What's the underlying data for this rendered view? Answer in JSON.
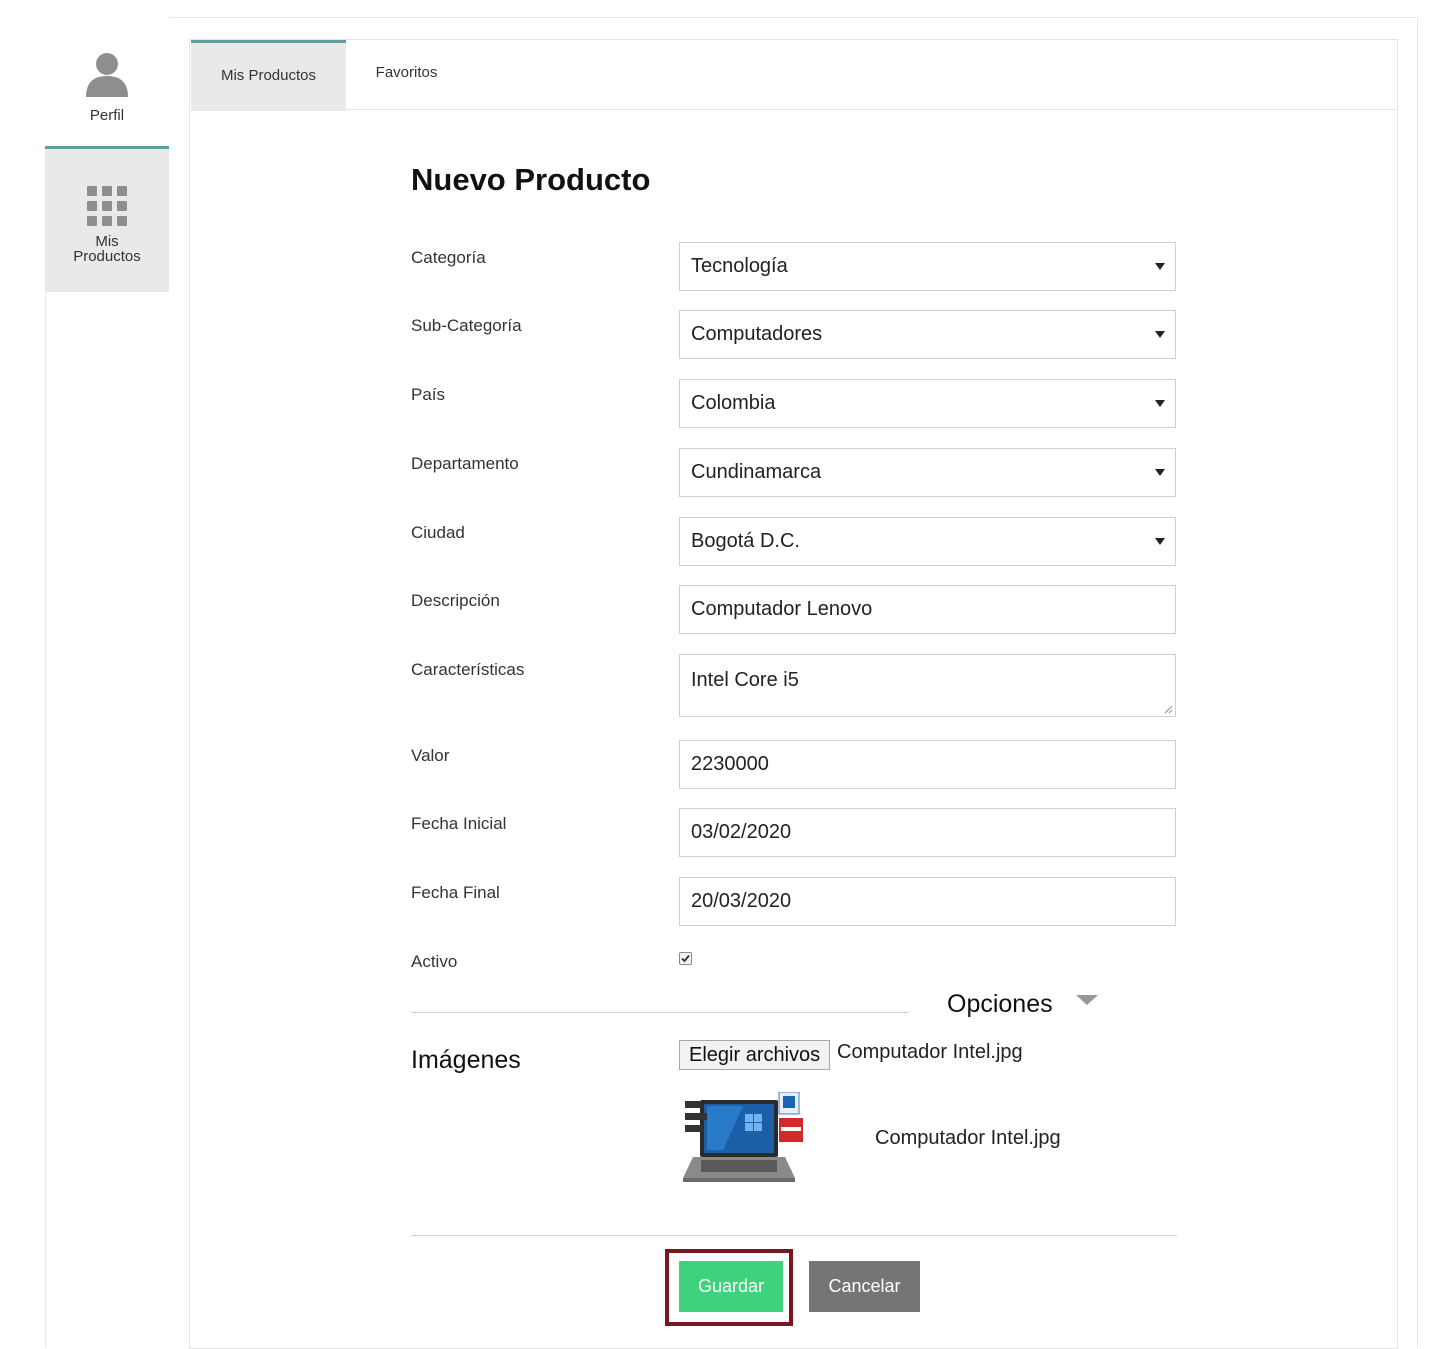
{
  "sidebar": {
    "items": [
      {
        "label": "Perfil",
        "icon": "user-icon"
      },
      {
        "label": "Mis\nProductos",
        "icon": "grid-icon"
      }
    ]
  },
  "tabs": [
    {
      "label": "Mis Productos",
      "active": true
    },
    {
      "label": "Favoritos",
      "active": false
    }
  ],
  "form": {
    "title": "Nuevo Producto",
    "fields": {
      "categoria": {
        "label": "Categoría",
        "value": "Tecnología"
      },
      "subcategoria": {
        "label": "Sub-Categoría",
        "value": "Computadores"
      },
      "pais": {
        "label": "País",
        "value": "Colombia"
      },
      "departamento": {
        "label": "Departamento",
        "value": "Cundinamarca"
      },
      "ciudad": {
        "label": "Ciudad",
        "value": "Bogotá D.C."
      },
      "descripcion": {
        "label": "Descripción",
        "value": "Computador Lenovo"
      },
      "caracteristicas": {
        "label": "Características",
        "value": "Intel Core i5"
      },
      "valor": {
        "label": "Valor",
        "value": "2230000"
      },
      "fecha_inicial": {
        "label": "Fecha Inicial",
        "value": "03/02/2020"
      },
      "fecha_final": {
        "label": "Fecha Final",
        "value": "20/03/2020"
      },
      "activo": {
        "label": "Activo",
        "checked": true
      }
    },
    "opciones_label": "Opciones",
    "imagenes": {
      "label": "Imágenes",
      "choose_button": "Elegir archivos",
      "selected_file": "Computador Intel.jpg",
      "preview_name": "Computador Intel.jpg"
    },
    "buttons": {
      "save": "Guardar",
      "cancel": "Cancelar"
    }
  },
  "colors": {
    "accent": "#5e9ea0",
    "save": "#3ed27e",
    "cancel": "#757575",
    "highlight_frame": "#7a1622"
  }
}
